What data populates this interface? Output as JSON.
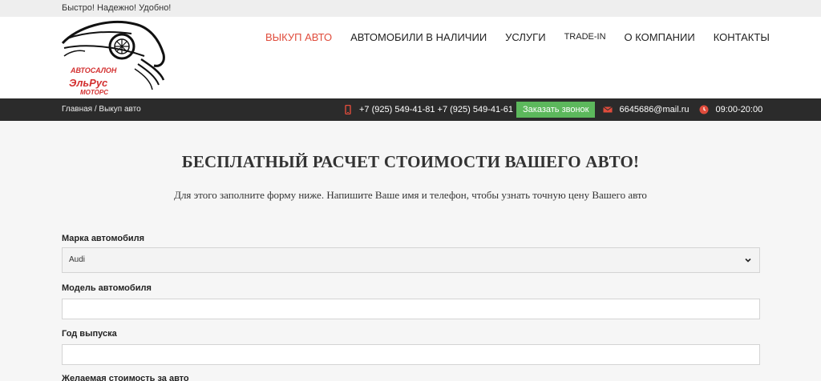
{
  "topbar": {
    "slogan": "Быстро! Надежно! Удобно!"
  },
  "logo": {
    "line1": "АВТОСАЛОН",
    "line2": "ЭльРус",
    "line3": "МОТОРС"
  },
  "nav": {
    "items": [
      {
        "label": "ВЫКУП АВТО",
        "active": true
      },
      {
        "label": "АВТОМОБИЛИ В НАЛИЧИИ"
      },
      {
        "label": "УСЛУГИ"
      },
      {
        "label": "TRADE-IN"
      },
      {
        "label": "О КОМПАНИИ"
      },
      {
        "label": "КОНТАКТЫ"
      }
    ]
  },
  "breadcrumb": {
    "home": "Главная",
    "sep": "/",
    "current": "Выкуп авто"
  },
  "contacts": {
    "phones": "+7 (925) 549-41-81 +7 (925) 549-41-61",
    "call_button": "Заказать звонок",
    "email": "6645686@mail.ru",
    "hours": "09:00-20:00",
    "icon_color": "#e04c3c"
  },
  "form": {
    "title": "БЕСПЛАТНЫЙ РАСЧЕТ СТОИМОСТИ ВАШЕГО АВТО!",
    "subtitle": "Для этого заполните форму ниже. Напишите Ваше имя и телефон, чтобы узнать точную цену Вашего авто",
    "make_label": "Марка автомобиля",
    "make_value": "Audi",
    "model_label": "Модель автомобиля",
    "model_value": "",
    "year_label": "Год выпуска",
    "year_value": "",
    "price_label": "Желаемая стоимость за авто"
  },
  "colors": {
    "accent": "#e04c3c",
    "dark_bar": "#2b2b2b",
    "call_green": "#5cb85c"
  }
}
